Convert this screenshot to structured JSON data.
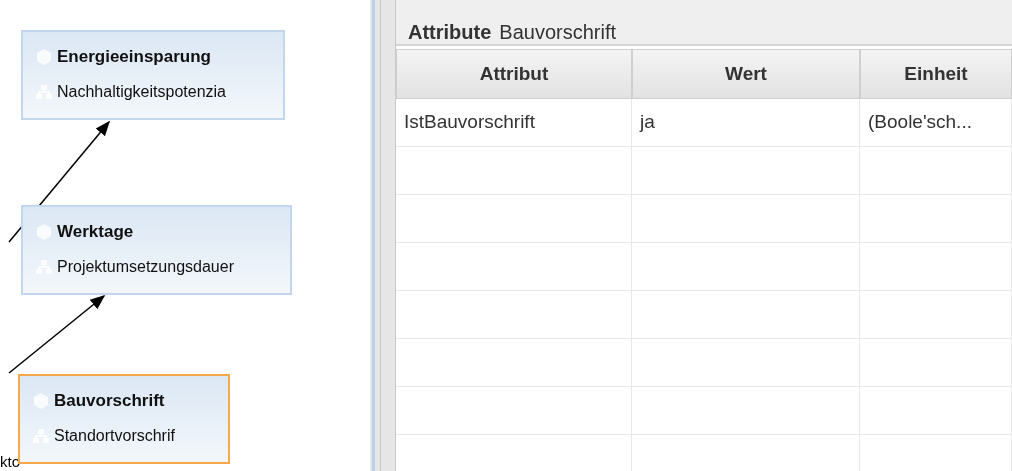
{
  "canvas": {
    "nodes": [
      {
        "title": "Energieeinsparung",
        "subtitle": "Nachhaltigkeitspotenzia",
        "selected": false
      },
      {
        "title": "Werktage",
        "subtitle": "Projektumsetzungsdauer",
        "selected": false
      },
      {
        "title": "Bauvorschrift",
        "subtitle": "Standortvorschrif",
        "selected": true
      }
    ],
    "partial_label": "kto"
  },
  "panel": {
    "heading": "Attribute",
    "subtitle": "Bauvorschrift",
    "table": {
      "columns": [
        "Attribut",
        "Wert",
        "Einheit"
      ],
      "rows": [
        [
          "IstBauvorschrift",
          "ja",
          "(Boole'sch..."
        ]
      ]
    }
  }
}
